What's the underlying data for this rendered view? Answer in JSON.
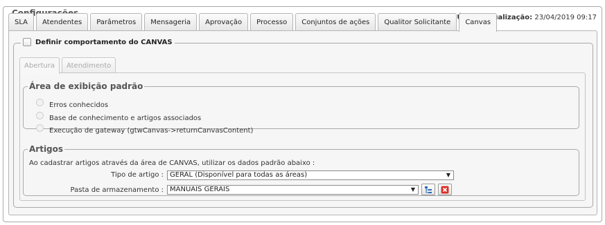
{
  "section_title": "Configurações",
  "tabs": [
    {
      "label": "SLA"
    },
    {
      "label": "Atendentes"
    },
    {
      "label": "Parâmetros"
    },
    {
      "label": "Mensageria"
    },
    {
      "label": "Aprovação"
    },
    {
      "label": "Processo"
    },
    {
      "label": "Conjuntos de ações"
    },
    {
      "label": "Qualitor Solicitante"
    },
    {
      "label": "Canvas"
    }
  ],
  "active_tab": "Canvas",
  "last_update": {
    "label": "Última atualização:",
    "value": "23/04/2019 09:17"
  },
  "canvas": {
    "checkbox_label": "Definir comportamento do CANVAS",
    "checked": false,
    "subtabs": [
      {
        "label": "Abertura"
      },
      {
        "label": "Atendimento"
      }
    ],
    "display_area": {
      "title": "Área de exibição padrão",
      "options": [
        {
          "label": "Erros conhecidos"
        },
        {
          "label": "Base de conhecimento e artigos associados"
        },
        {
          "label": "Execução de gateway (gtwCanvas->returnCanvasContent)"
        }
      ]
    },
    "articles": {
      "title": "Artigos",
      "intro": "Ao cadastrar artigos através da área de CANVAS, utilizar os dados padrão abaixo :",
      "article_type_label": "Tipo de artigo :",
      "article_type_value": "GERAL (Disponível para todas as áreas)",
      "storage_folder_label": "Pasta de armazenamento :",
      "storage_folder_value": "MANUAIS GERAIS"
    }
  },
  "icons": {
    "tree": "tree-icon",
    "clear": "clear-x-icon",
    "dropdown": "chevron-down-icon"
  },
  "colors": {
    "clear_red": "#d9322a",
    "tree_blue": "#2a6bb8"
  }
}
